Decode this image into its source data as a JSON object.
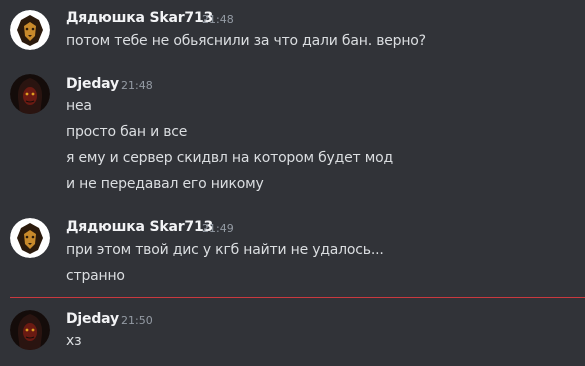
{
  "messages": [
    {
      "author": "Дядюшка Skar713",
      "time": "21:48",
      "avatar_icon": "lion-avatar-icon",
      "lines": [
        "потом тебе не обьяснили за что дали бан. верно?"
      ]
    },
    {
      "author": "Djeday",
      "time": "21:48",
      "avatar_icon": "sith-avatar-icon",
      "lines": [
        "неа",
        "просто бан и все",
        "я ему и сервер скидвл на котором будет мод",
        "и не передавал его никому"
      ]
    },
    {
      "author": "Дядюшка Skar713",
      "time": "21:49",
      "avatar_icon": "lion-avatar-icon",
      "lines": [
        "при этом твой дис у кгб найти не удалось...",
        "странно"
      ]
    },
    {
      "author": "Djeday",
      "time": "21:50",
      "avatar_icon": "sith-avatar-icon",
      "lines": [
        "хз"
      ]
    }
  ],
  "colors": {
    "background": "#313338",
    "author": "#f2f3f5",
    "text": "#dbdee1",
    "timestamp": "#949ba4",
    "new_messages_divider": "#c9393f"
  }
}
